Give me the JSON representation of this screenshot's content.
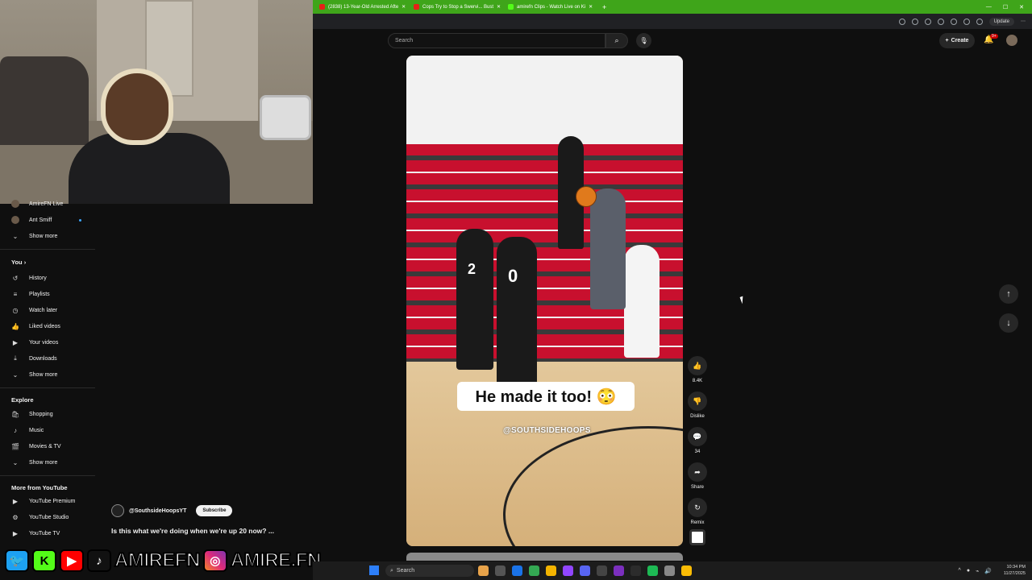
{
  "browser": {
    "tabs": [
      {
        "label": "(2838) 13-Year-Old Arrested Afte"
      },
      {
        "label": "Cops Try to Stop a Swervi... Bust"
      },
      {
        "label": "amirefn Clips - Watch Live on Ki"
      }
    ],
    "new_tab": "+",
    "update_label": "Update"
  },
  "youtube": {
    "search_placeholder": "Search",
    "create_label": "Create",
    "notif_count": "9+"
  },
  "sidebar": {
    "subs": [
      {
        "label": "AmireFN Live"
      },
      {
        "label": "Ant Smiff"
      }
    ],
    "show_more": "Show more",
    "you_header": "You",
    "you_items": [
      {
        "label": "History",
        "icon": "history-icon"
      },
      {
        "label": "Playlists",
        "icon": "playlists-icon"
      },
      {
        "label": "Watch later",
        "icon": "clock-icon"
      },
      {
        "label": "Liked videos",
        "icon": "thumbs-up-icon"
      },
      {
        "label": "Your videos",
        "icon": "play-square-icon"
      },
      {
        "label": "Downloads",
        "icon": "download-icon"
      }
    ],
    "explore_header": "Explore",
    "explore_items": [
      {
        "label": "Shopping",
        "icon": "bag-icon"
      },
      {
        "label": "Music",
        "icon": "music-note-icon"
      },
      {
        "label": "Movies & TV",
        "icon": "film-icon"
      }
    ],
    "more_header": "More from YouTube",
    "more_items": [
      {
        "label": "YouTube Premium"
      },
      {
        "label": "YouTube Studio"
      },
      {
        "label": "YouTube TV"
      }
    ]
  },
  "short": {
    "caption": "He made it too! 😳",
    "watermark": "@SOUTHSIDEHOOPS",
    "jersey_2": "2",
    "jersey_0": "0",
    "channel": "@SouthsideHoopsYT",
    "subscribe_label": "Subscribe",
    "title": "Is this what we're doing when we're up 20 now? ..."
  },
  "actions": {
    "like_count": "8.4K",
    "dislike_label": "Dislike",
    "comment_count": "34",
    "share_label": "Share",
    "remix_label": "Remix"
  },
  "banner": {
    "handle1": "AMIREFN",
    "handle2": "AMIRE.FN"
  },
  "taskbar": {
    "search_label": "Search",
    "time": "10:34 PM",
    "date": "11/27/2025"
  }
}
